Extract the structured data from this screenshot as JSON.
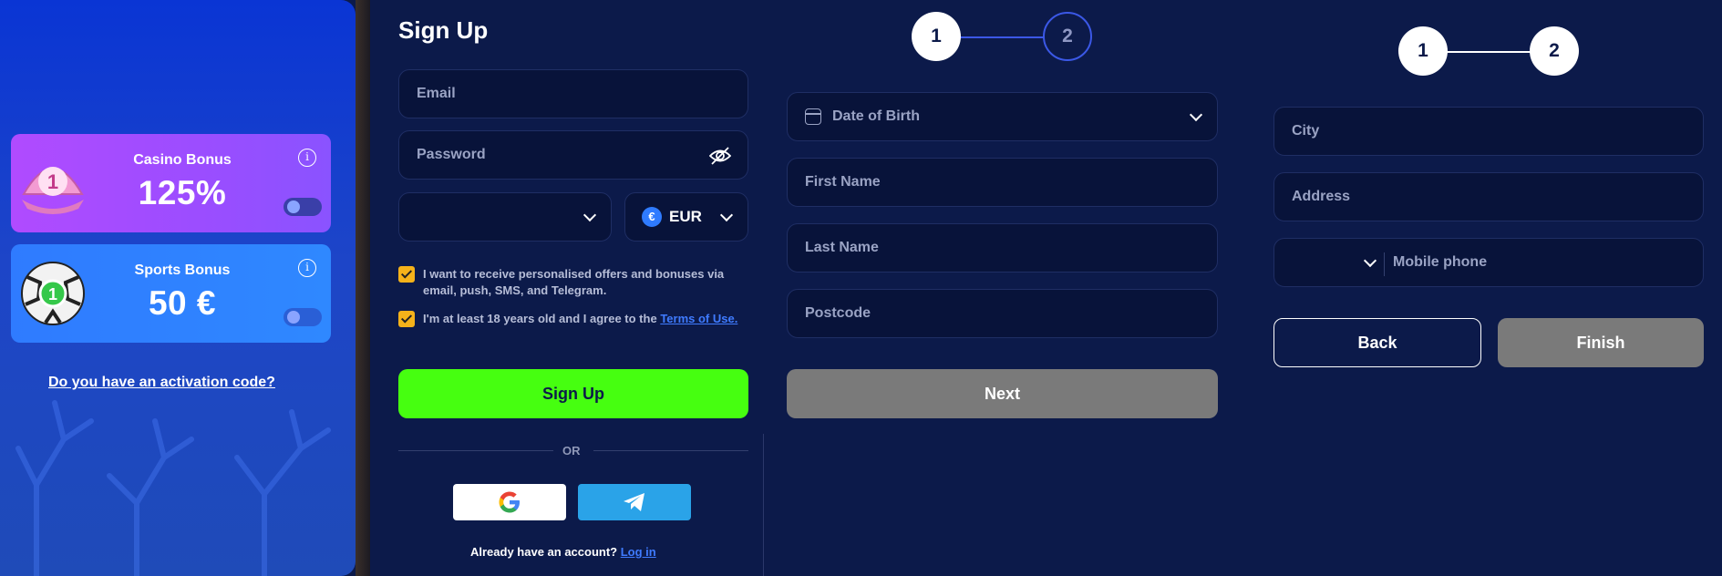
{
  "promo": {
    "casino": {
      "title": "Casino Bonus",
      "value": "125%",
      "badge": "1"
    },
    "sports": {
      "title": "Sports Bonus",
      "value": "50 €",
      "badge": "1"
    },
    "activation_link": "Do you have an activation code?"
  },
  "signup": {
    "title": "Sign Up",
    "email_placeholder": "Email",
    "password_placeholder": "Password",
    "currency_symbol": "€",
    "currency": "EUR",
    "consent_offers": "I want to receive personalised offers and bonuses via email, push, SMS, and Telegram.",
    "consent_age_prefix": "I'm at least 18 years old and I agree to the ",
    "consent_terms_link": "Terms of Use.",
    "signup_button": "Sign Up",
    "or_label": "OR",
    "account_prompt": "Already have an account? ",
    "login_link": "Log in"
  },
  "step_form_1": {
    "steps": [
      "1",
      "2"
    ],
    "dob_placeholder": "Date of Birth",
    "first_name_placeholder": "First Name",
    "last_name_placeholder": "Last Name",
    "postcode_placeholder": "Postcode",
    "next_button": "Next"
  },
  "step_form_2": {
    "steps": [
      "1",
      "2"
    ],
    "city_placeholder": "City",
    "address_placeholder": "Address",
    "mobile_placeholder": "Mobile phone",
    "back_button": "Back",
    "finish_button": "Finish"
  },
  "colors": {
    "background": "#0c1a4a",
    "field": "#08133a",
    "signup_green": "#46ff10",
    "disabled_gray": "#7a7a7a",
    "link_blue": "#3f7bff",
    "checkbox_yellow": "#f5b21a"
  }
}
